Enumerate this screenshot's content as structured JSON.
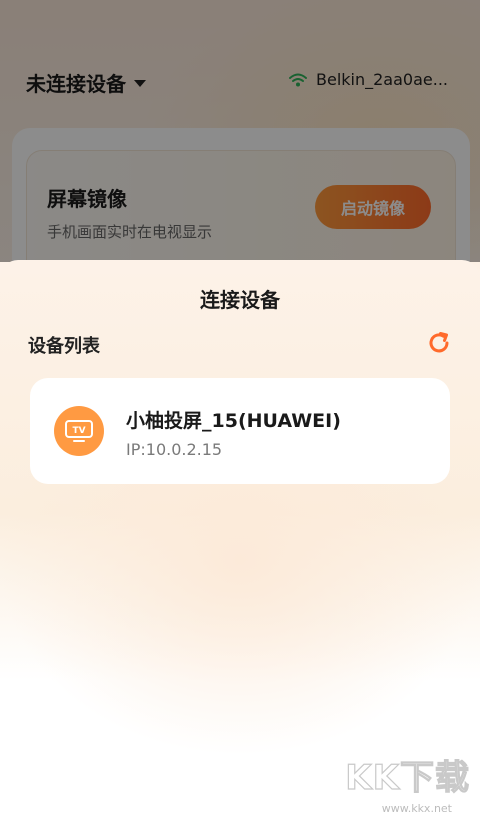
{
  "header": {
    "device_status": "未连接设备",
    "wifi_name": "Belkin_2aa0ae..."
  },
  "mirror_card": {
    "title": "屏幕镜像",
    "subtitle": "手机画面实时在电视显示",
    "button_label": "启动镜像"
  },
  "sheet": {
    "title": "连接设备",
    "section_label": "设备列表",
    "devices": [
      {
        "name": "小柚投屏_15(HUAWEI)",
        "ip": "IP:10.0.2.15",
        "icon": "tv-icon",
        "icon_text": "TV"
      }
    ]
  },
  "watermark": {
    "text": "KK下载",
    "url": "www.kkx.net"
  },
  "colors": {
    "accent": "#ff7a2f",
    "tv_icon_bg": "#ff9a42",
    "wifi_green": "#2fb35a"
  }
}
